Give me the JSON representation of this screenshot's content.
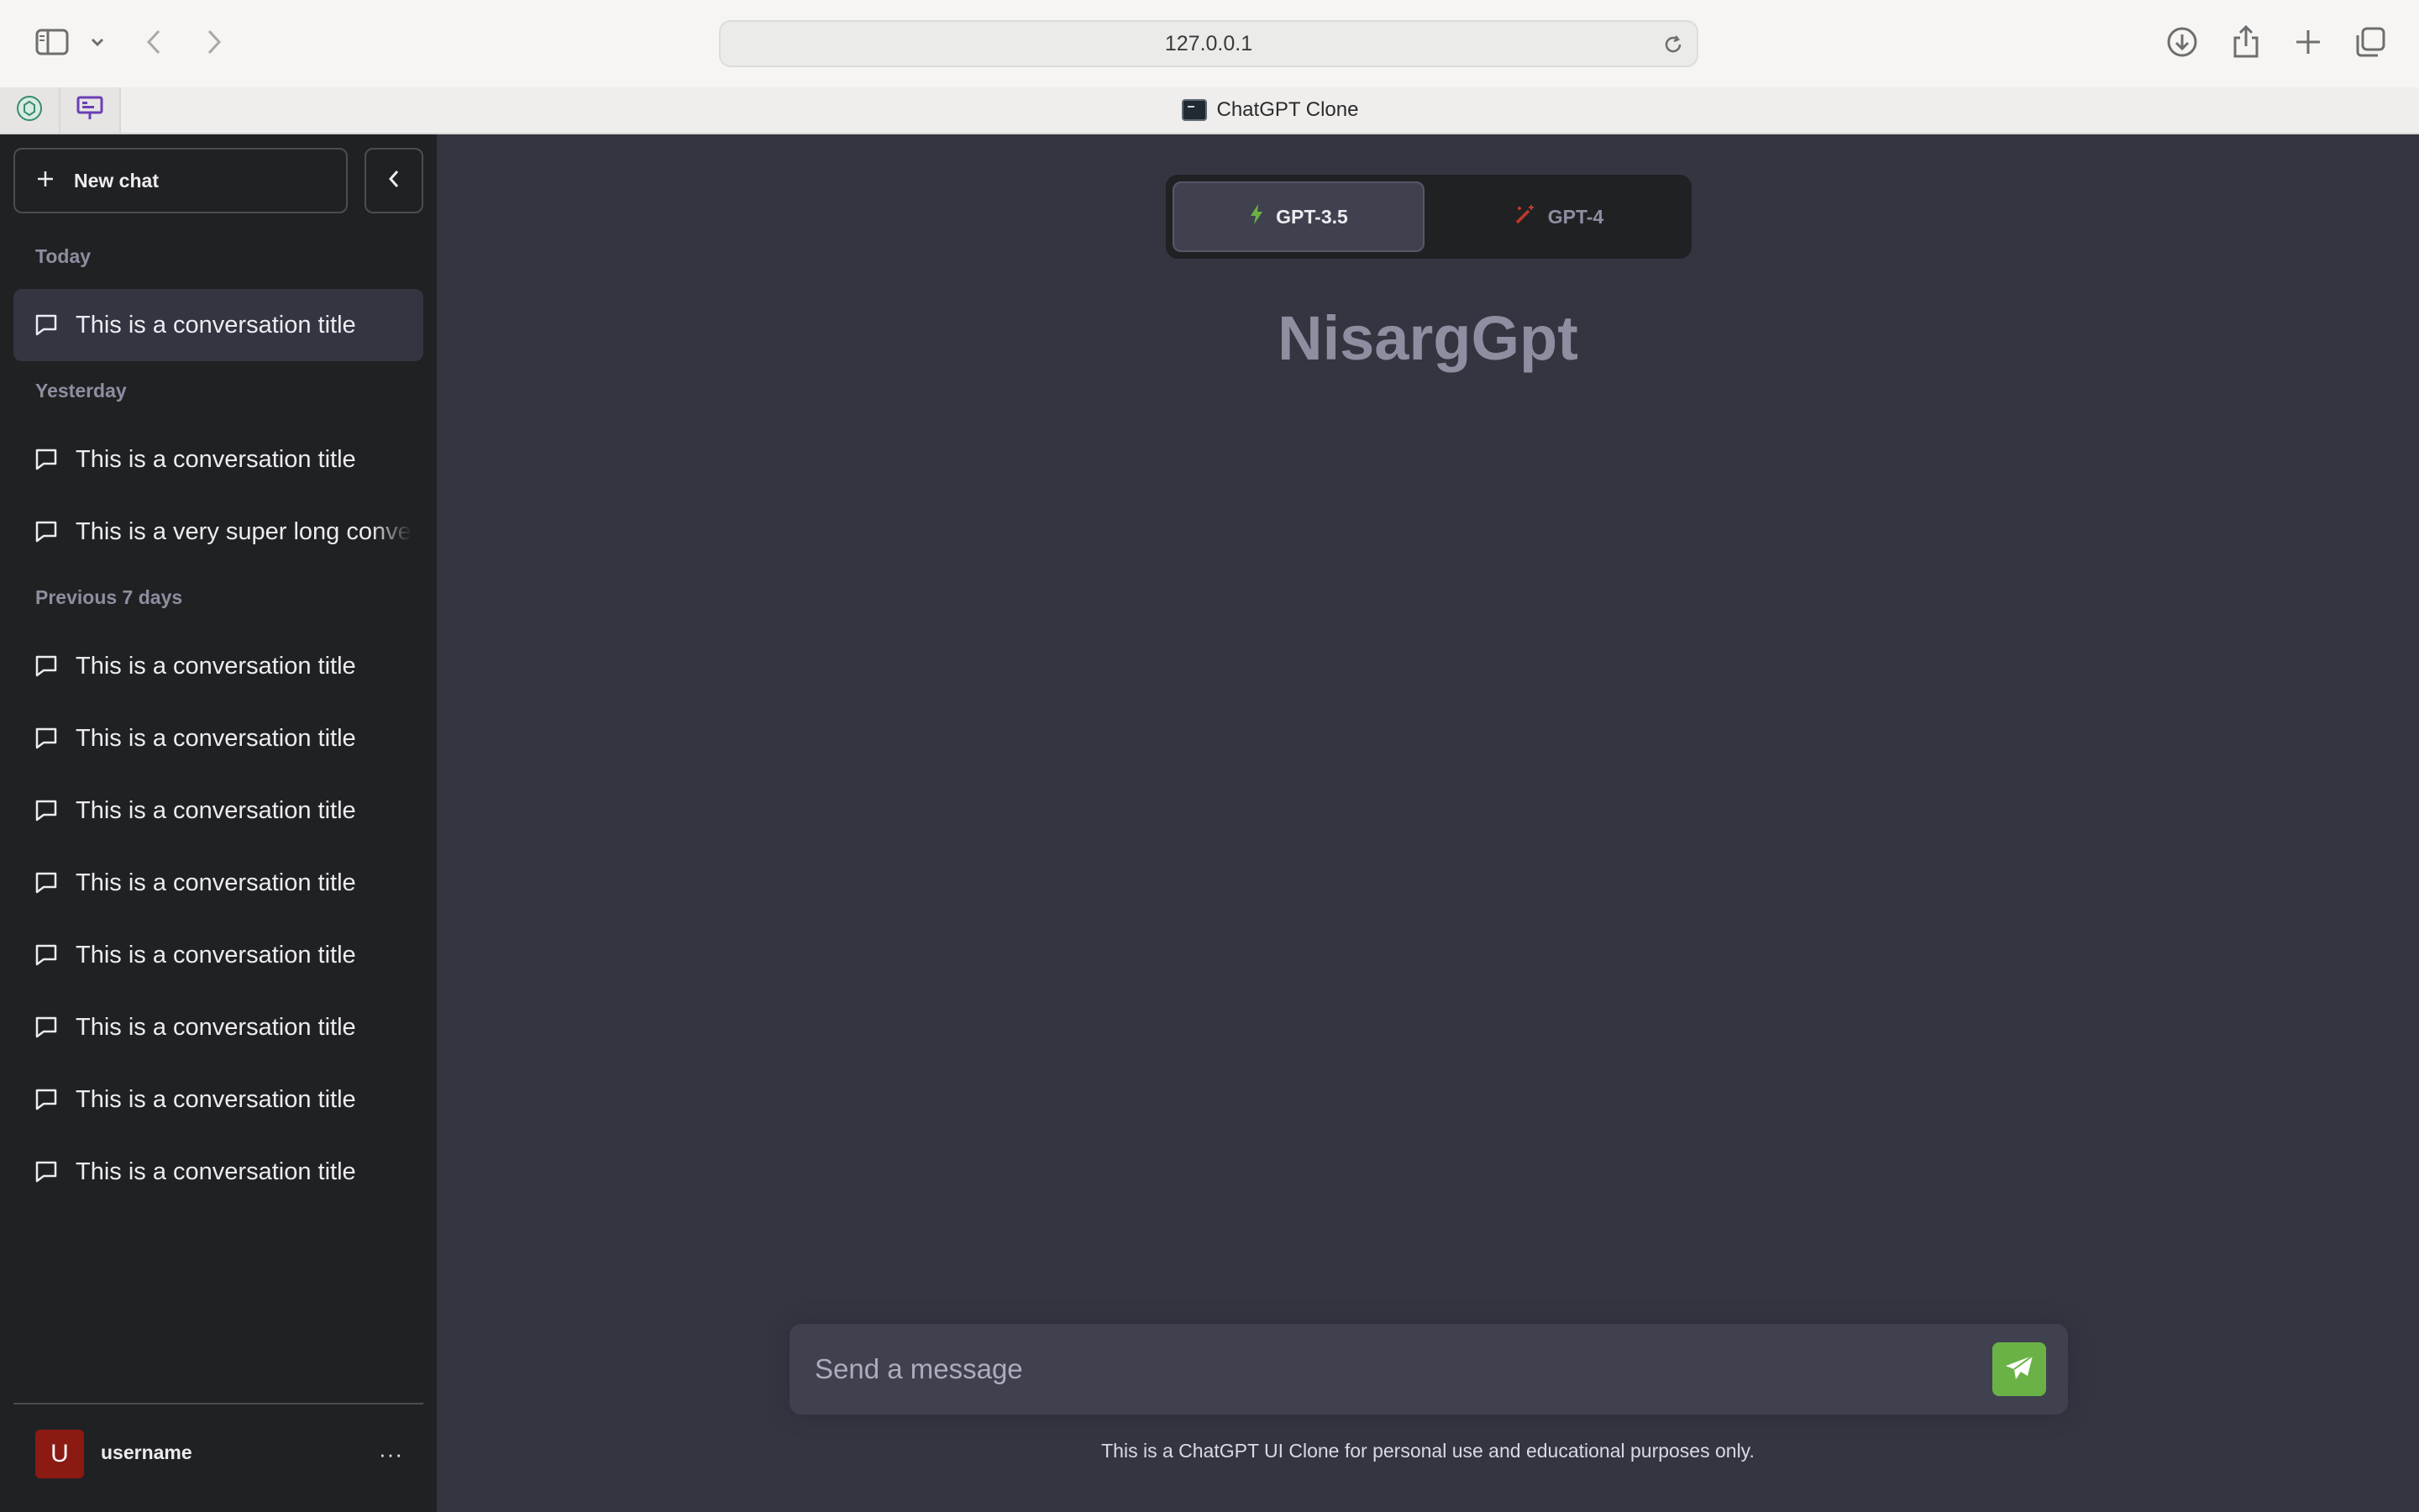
{
  "browser": {
    "url": "127.0.0.1",
    "tab_title": "ChatGPT Clone"
  },
  "sidebar": {
    "new_chat_label": "New chat",
    "sections": [
      {
        "label": "Today",
        "items": [
          "This is a conversation title"
        ]
      },
      {
        "label": "Yesterday",
        "items": [
          "This is a conversation title",
          "This is a very super long conversation title"
        ]
      },
      {
        "label": "Previous 7 days",
        "items": [
          "This is a conversation title",
          "This is a conversation title",
          "This is a conversation title",
          "This is a conversation title",
          "This is a conversation title",
          "This is a conversation title",
          "This is a conversation title",
          "This is a conversation title"
        ]
      }
    ],
    "active_item": "This is a conversation title",
    "user": {
      "avatar_letter": "U",
      "name": "username",
      "menu_glyph": "···"
    }
  },
  "main": {
    "models": [
      {
        "label": "GPT-3.5",
        "selected": true,
        "icon": "bolt-icon",
        "color": "#6ab245"
      },
      {
        "label": "GPT-4",
        "selected": false,
        "icon": "magic-wand-icon",
        "color": "#c0392b"
      }
    ],
    "brand_title": "NisargGpt",
    "input": {
      "placeholder": "Send a message",
      "value": ""
    },
    "send_icon": "paper-plane-icon",
    "disclaimer": "This is a ChatGPT UI Clone for personal use and educational purposes only."
  },
  "colors": {
    "sidebar_bg": "#202123",
    "main_bg": "#343541",
    "accent": "#6ab245",
    "avatar_bg": "#8b1a13"
  }
}
